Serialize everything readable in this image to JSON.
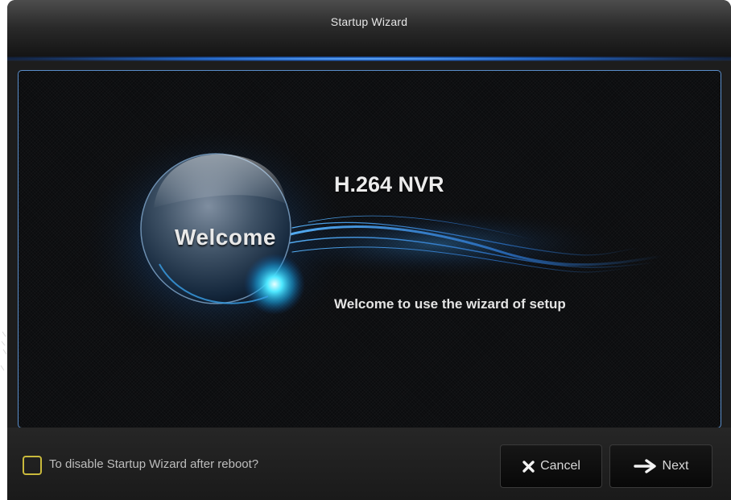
{
  "window": {
    "title": "Startup Wizard"
  },
  "content": {
    "orb_label": "Welcome",
    "product_name": "H.264 NVR",
    "message": "Welcome to use the wizard of setup"
  },
  "footer": {
    "disable_checkbox": {
      "label": "To disable Startup Wizard after reboot?",
      "checked": false
    },
    "cancel_button": {
      "label": "Cancel",
      "icon": "close-icon"
    },
    "next_button": {
      "label": "Next",
      "icon": "arrow-right-icon"
    }
  },
  "colors": {
    "accent_blue": "#2f7fe0",
    "checkbox_border": "#c9b93c",
    "panel_border": "#5a8ecb"
  }
}
